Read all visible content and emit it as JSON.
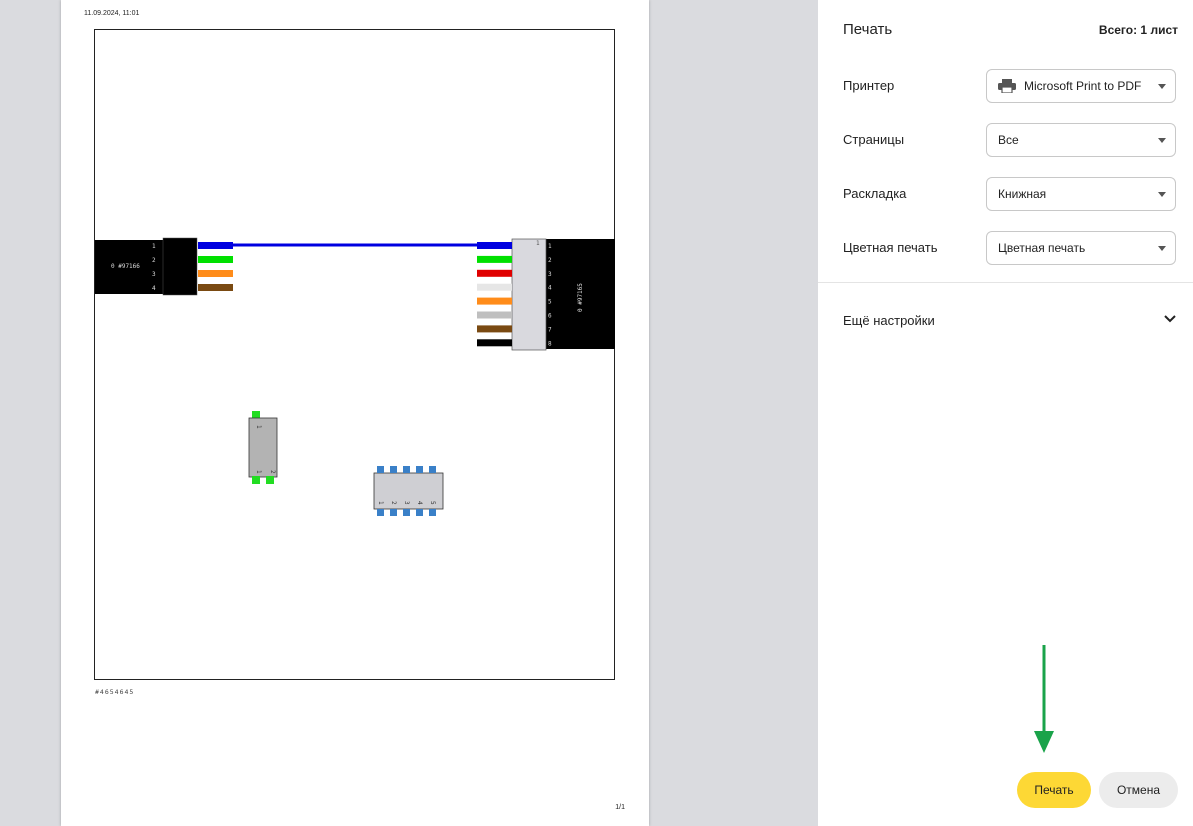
{
  "preview": {
    "date": "11.09.2024, 11:01",
    "page_number": "1/1",
    "document_code": "#4654645",
    "left_connector": {
      "label": "0 #97166",
      "pins": [
        "1",
        "2",
        "3",
        "4"
      ],
      "wire_colors": [
        "#0000e0",
        "#00e000",
        "#ff8c1a",
        "#7a4a12"
      ]
    },
    "right_connector": {
      "label": "0 #97165",
      "pins": [
        "1",
        "2",
        "3",
        "4",
        "5",
        "6",
        "7",
        "8"
      ],
      "wire_colors": [
        "#0000e0",
        "#00e000",
        "#e00000",
        "#e6e6e6",
        "#ff8c1a",
        "#bfbfbf",
        "#7a4a12",
        "#000000"
      ]
    },
    "small_component": {
      "top_pin": "1",
      "bottom_pins": [
        "1",
        "2"
      ],
      "pin_color": "#22dd22"
    },
    "chip_component": {
      "pins": [
        "1",
        "2",
        "3",
        "4",
        "5"
      ],
      "pin_color": "#3a80c8"
    },
    "cable_color": "#0000e0"
  },
  "panel": {
    "title": "Печать",
    "total": "Всего: 1 лист",
    "printer_label": "Принтер",
    "printer_value": "Microsoft Print to PDF",
    "printer_icon": "printer-icon",
    "pages_label": "Страницы",
    "pages_value": "Все",
    "layout_label": "Раскладка",
    "layout_value": "Книжная",
    "color_label": "Цветная печать",
    "color_value": "Цветная печать",
    "more_settings": "Ещё настройки",
    "print_button": "Печать",
    "cancel_button": "Отмена"
  },
  "colors": {
    "accent_button": "#fdd835",
    "arrow": "#1aa34a"
  }
}
